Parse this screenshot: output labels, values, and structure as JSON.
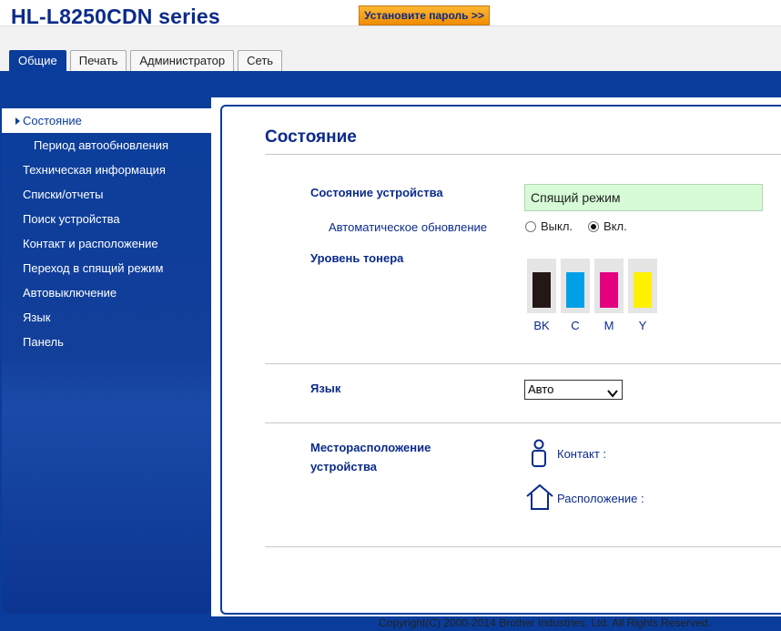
{
  "app": {
    "title": "HL-L8250CDN series",
    "set_password_button": "Установите пароль >>"
  },
  "tabs": [
    {
      "label": "Общие",
      "active": true
    },
    {
      "label": "Печать",
      "active": false
    },
    {
      "label": "Администратор",
      "active": false
    },
    {
      "label": "Сеть",
      "active": false
    }
  ],
  "sidebar": {
    "items": [
      {
        "label": "Состояние",
        "active": true
      },
      {
        "label": "Период автообновления",
        "sub": true
      },
      {
        "label": "Техническая информация"
      },
      {
        "label": "Списки/отчеты"
      },
      {
        "label": "Поиск устройства"
      },
      {
        "label": "Контакт и расположение"
      },
      {
        "label": "Переход в спящий режим"
      },
      {
        "label": "Автовыключение"
      },
      {
        "label": "Язык"
      },
      {
        "label": "Панель"
      }
    ]
  },
  "main": {
    "page_title": "Состояние",
    "device_status_label": "Состояние устройства",
    "device_status_value": "Спящий режим",
    "auto_update_label": "Автоматическое обновление",
    "auto_update_off": "Выкл.",
    "auto_update_on": "Вкл.",
    "auto_update_selected": "on",
    "toner_label": "Уровень тонера",
    "toners": [
      {
        "label": "BK",
        "color": "#231815",
        "level": 0.82
      },
      {
        "label": "C",
        "color": "#00a0e9",
        "level": 0.82
      },
      {
        "label": "M",
        "color": "#e4007f",
        "level": 0.82
      },
      {
        "label": "Y",
        "color": "#fff100",
        "level": 0.82
      }
    ],
    "language_label": "Язык",
    "language_value": "Авто",
    "location_label_line1": "Месторасположение",
    "location_label_line2": "устройства",
    "contact_label": "Контакт :",
    "location_label": "Расположение :"
  },
  "footer": {
    "copyright": "Copyright(C) 2000-2014 Brother Industries, Ltd. All Rights Reserved."
  },
  "colors": {
    "brand_blue": "#0a3d9b",
    "status_green": "#d6fbd6",
    "button_orange": "#f5a623"
  }
}
